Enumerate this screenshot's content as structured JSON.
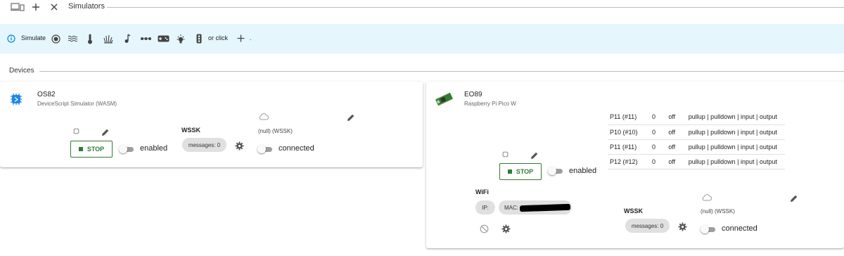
{
  "header": {
    "title": "Simulators",
    "icons": [
      "devices-icon",
      "add-icon",
      "close-icon"
    ]
  },
  "info": {
    "simulate_label": "Simulate",
    "or_click": "or click",
    "trailing": ".",
    "sensor_icons": [
      "button-icon",
      "waves-icon",
      "thermometer-icon",
      "grass-icon",
      "music-note-icon",
      "dots-line-icon",
      "gamepad-icon",
      "light-icon",
      "traffic-icon"
    ]
  },
  "devices": {
    "title": "Devices",
    "os82": {
      "name": "OS82",
      "description": "DeviceScript Simulator (WASM)",
      "stop_label": "STOP",
      "enabled_label": "enabled",
      "wssk_label": "WSSK",
      "messages_label": "messages: 0",
      "cloud_status": "(null) (WSSK)",
      "connected_label": "connected"
    },
    "eo89": {
      "name": "EO89",
      "description": "Raspberry Pi Pico W",
      "stop_label": "STOP",
      "enabled_label": "enabled",
      "wifi_label": "WiFi",
      "ip_label": "IP:",
      "mac_label": "MAC:",
      "wssk_label": "WSSK",
      "messages_label": "messages: 0",
      "cloud_status": "(null) (WSSK)",
      "connected_label": "connected",
      "pins": [
        {
          "name": "P11 (#11)",
          "value": "0",
          "mode": "off",
          "options": "pullup | pulldown | input | output"
        },
        {
          "name": "P10 (#10)",
          "value": "0",
          "mode": "off",
          "options": "pullup | pulldown | input | output"
        },
        {
          "name": "P11 (#11)",
          "value": "0",
          "mode": "off",
          "options": "pullup | pulldown | input | output"
        },
        {
          "name": "P12 (#12)",
          "value": "0",
          "mode": "off",
          "options": "pullup | pulldown | input | output"
        }
      ]
    }
  },
  "colors": {
    "info_bg": "#e5f6fd",
    "info_icon": "#0288d1",
    "stop_green": "#2e7d32"
  }
}
